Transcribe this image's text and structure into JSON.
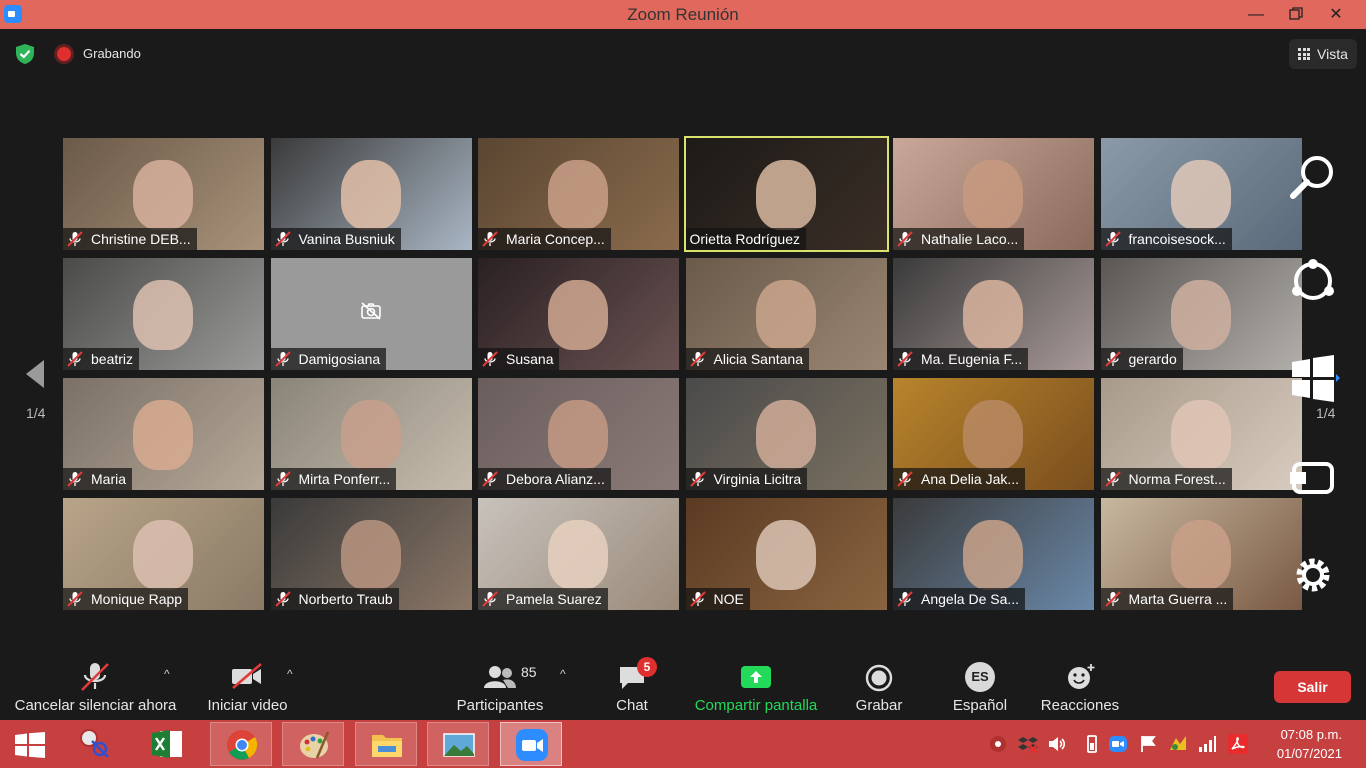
{
  "window": {
    "title": "Zoom Reunión"
  },
  "topbar": {
    "recording_label": "Grabando",
    "view_label": "Vista"
  },
  "gallery": {
    "page_left": "1/4",
    "page_right": "1/4",
    "tiles": [
      {
        "name": "Christine DEB...",
        "muted": true
      },
      {
        "name": "Vanina Busniuk",
        "muted": true
      },
      {
        "name": "Maria Concep...",
        "muted": true
      },
      {
        "name": "Orietta Rodríguez",
        "muted": false,
        "active": true
      },
      {
        "name": "Nathalie Laco...",
        "muted": true
      },
      {
        "name": "francoisesock...",
        "muted": true
      },
      {
        "name": "beatriz",
        "muted": true
      },
      {
        "name": "Damigosiana",
        "muted": true,
        "camera_off": true
      },
      {
        "name": "Susana",
        "muted": true
      },
      {
        "name": "Alicia Santana",
        "muted": true
      },
      {
        "name": "Ma. Eugenia F...",
        "muted": true
      },
      {
        "name": "gerardo",
        "muted": true
      },
      {
        "name": "Maria",
        "muted": true
      },
      {
        "name": "Mirta Ponferr...",
        "muted": true
      },
      {
        "name": "Debora Alianz...",
        "muted": true
      },
      {
        "name": "Virginia Licitra",
        "muted": true
      },
      {
        "name": "Ana Delia Jak...",
        "muted": true
      },
      {
        "name": "Norma Forest...",
        "muted": true
      },
      {
        "name": "Monique Rapp",
        "muted": true
      },
      {
        "name": "Norberto Traub",
        "muted": true
      },
      {
        "name": "Pamela Suarez",
        "muted": true
      },
      {
        "name": "NOE",
        "muted": true
      },
      {
        "name": "Angela De Sa...",
        "muted": true
      },
      {
        "name": "Marta Guerra ...",
        "muted": true
      }
    ]
  },
  "toolbar": {
    "unmute_label": "Cancelar silenciar ahora",
    "video_label": "Iniciar video",
    "participants_label": "Participantes",
    "participants_count": "85",
    "chat_label": "Chat",
    "chat_badge": "5",
    "share_label": "Compartir pantalla",
    "record_label": "Grabar",
    "language_code": "ES",
    "language_label": "Español",
    "reactions_label": "Reacciones",
    "leave_label": "Salir"
  },
  "taskbar": {
    "time": "07:08 p.m.",
    "date": "01/07/2021"
  },
  "colors": {
    "titlebar": "#e0685c",
    "taskbar": "#c64040",
    "share_green": "#23d959",
    "leave_red": "#d63636",
    "active_speaker": "#d9e26b"
  }
}
